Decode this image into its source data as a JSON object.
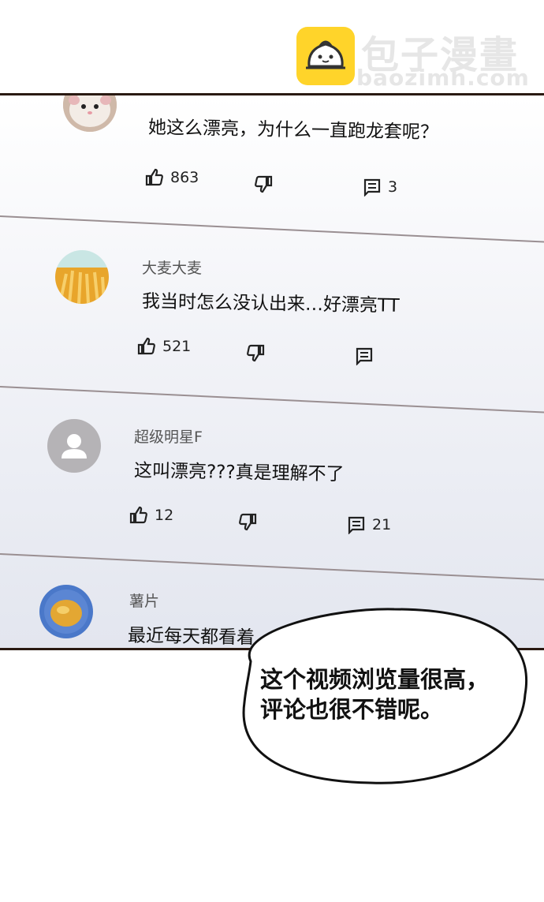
{
  "watermark": {
    "site_name": "包子漫畫",
    "site_url": "baozimh.com"
  },
  "comments": [
    {
      "username": "",
      "text": "她这么漂亮，为什么一直跑龙套呢？",
      "likes": "863",
      "replies": "3",
      "avatar": "hamster-avatar-icon"
    },
    {
      "username": "大麦大麦",
      "text": "我当时怎么没认出来…好漂亮TT",
      "likes": "521",
      "replies": "",
      "avatar": "wheat-field-avatar-icon"
    },
    {
      "username": "超级明星F",
      "text": "这叫漂亮???真是理解不了",
      "likes": "12",
      "replies": "21",
      "avatar": "default-user-avatar-icon"
    },
    {
      "username": "薯片",
      "text": "最近每天都看着",
      "likes": "",
      "replies": "",
      "avatar": "potato-chip-avatar-icon"
    }
  ],
  "speech_bubble": {
    "line1": "这个视频浏览量很高，",
    "line2": "评论也很不错呢。"
  },
  "colors": {
    "logo_yellow": "#ffd42a",
    "panel_border": "#2a1a12"
  }
}
